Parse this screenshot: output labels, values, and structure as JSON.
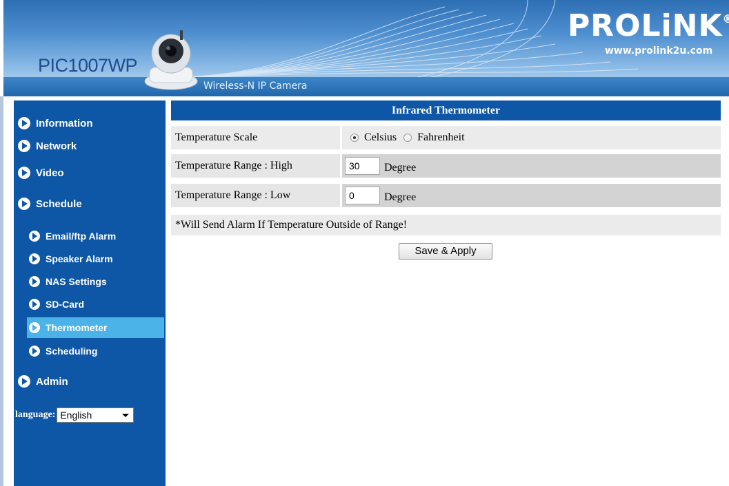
{
  "header": {
    "model": "PIC1007WP",
    "tagline": "Wireless-N IP Camera",
    "brand": "PROLiNK",
    "brand_mark": "®",
    "url": "www.prolink2u.com"
  },
  "sidebar": {
    "items": [
      {
        "label": "Information",
        "level": "main"
      },
      {
        "label": "Network",
        "level": "main"
      },
      {
        "label": "Video",
        "level": "main"
      },
      {
        "label": "Schedule",
        "level": "main"
      },
      {
        "label": "Email/ftp Alarm",
        "level": "sub"
      },
      {
        "label": "Speaker Alarm",
        "level": "sub"
      },
      {
        "label": "NAS Settings",
        "level": "sub"
      },
      {
        "label": "SD-Card",
        "level": "sub"
      },
      {
        "label": "Thermometer",
        "level": "sub",
        "active": true
      },
      {
        "label": "Scheduling",
        "level": "sub"
      },
      {
        "label": "Admin",
        "level": "main"
      }
    ],
    "language_label": "language:",
    "language_value": "English"
  },
  "main": {
    "title": "Infrared Thermometer",
    "scale": {
      "label": "Temperature Scale",
      "options": [
        "Celsius",
        "Fahrenheit"
      ],
      "selected": "Celsius"
    },
    "range_high": {
      "label": "Temperature Range : High",
      "value": "30",
      "unit": "Degree"
    },
    "range_low": {
      "label": "Temperature Range : Low",
      "value": "0",
      "unit": "Degree"
    },
    "note": "*Will Send Alarm If Temperature Outside of Range!",
    "save_label": "Save & Apply"
  },
  "colors": {
    "sidebar_bg": "#0d57a6",
    "active_item_bg": "#4cb3e8",
    "title_bar_bg": "#0d57a6"
  }
}
